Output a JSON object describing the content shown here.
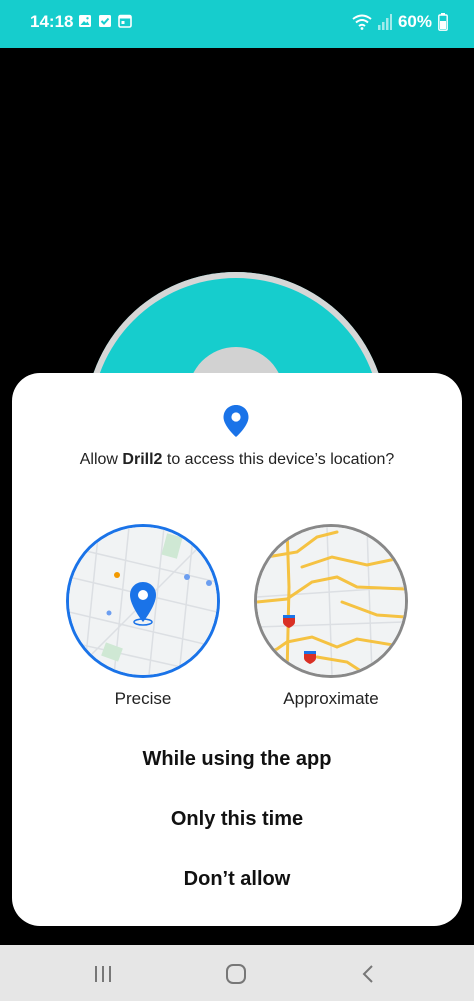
{
  "status_bar": {
    "time": "14:18",
    "battery": "60%"
  },
  "dialog": {
    "title_prefix": "Allow ",
    "app_name": "Drill2",
    "title_suffix": " to access this device’s location?",
    "precise_label": "Precise",
    "approximate_label": "Approximate",
    "options": {
      "while_using": "While using the app",
      "only_this_time": "Only this time",
      "dont_allow": "Don’t allow"
    }
  },
  "colors": {
    "status_bar": "#16cdcd",
    "accent_blue": "#1a73e8",
    "map_road_yellow": "#f5c242"
  },
  "icons": {
    "status_left": [
      "image-icon",
      "check-square-icon",
      "calendar-icon"
    ],
    "status_right": [
      "wifi-icon",
      "signal-icon",
      "battery-icon"
    ],
    "nav": [
      "recent-apps-icon",
      "home-icon",
      "back-icon"
    ]
  }
}
